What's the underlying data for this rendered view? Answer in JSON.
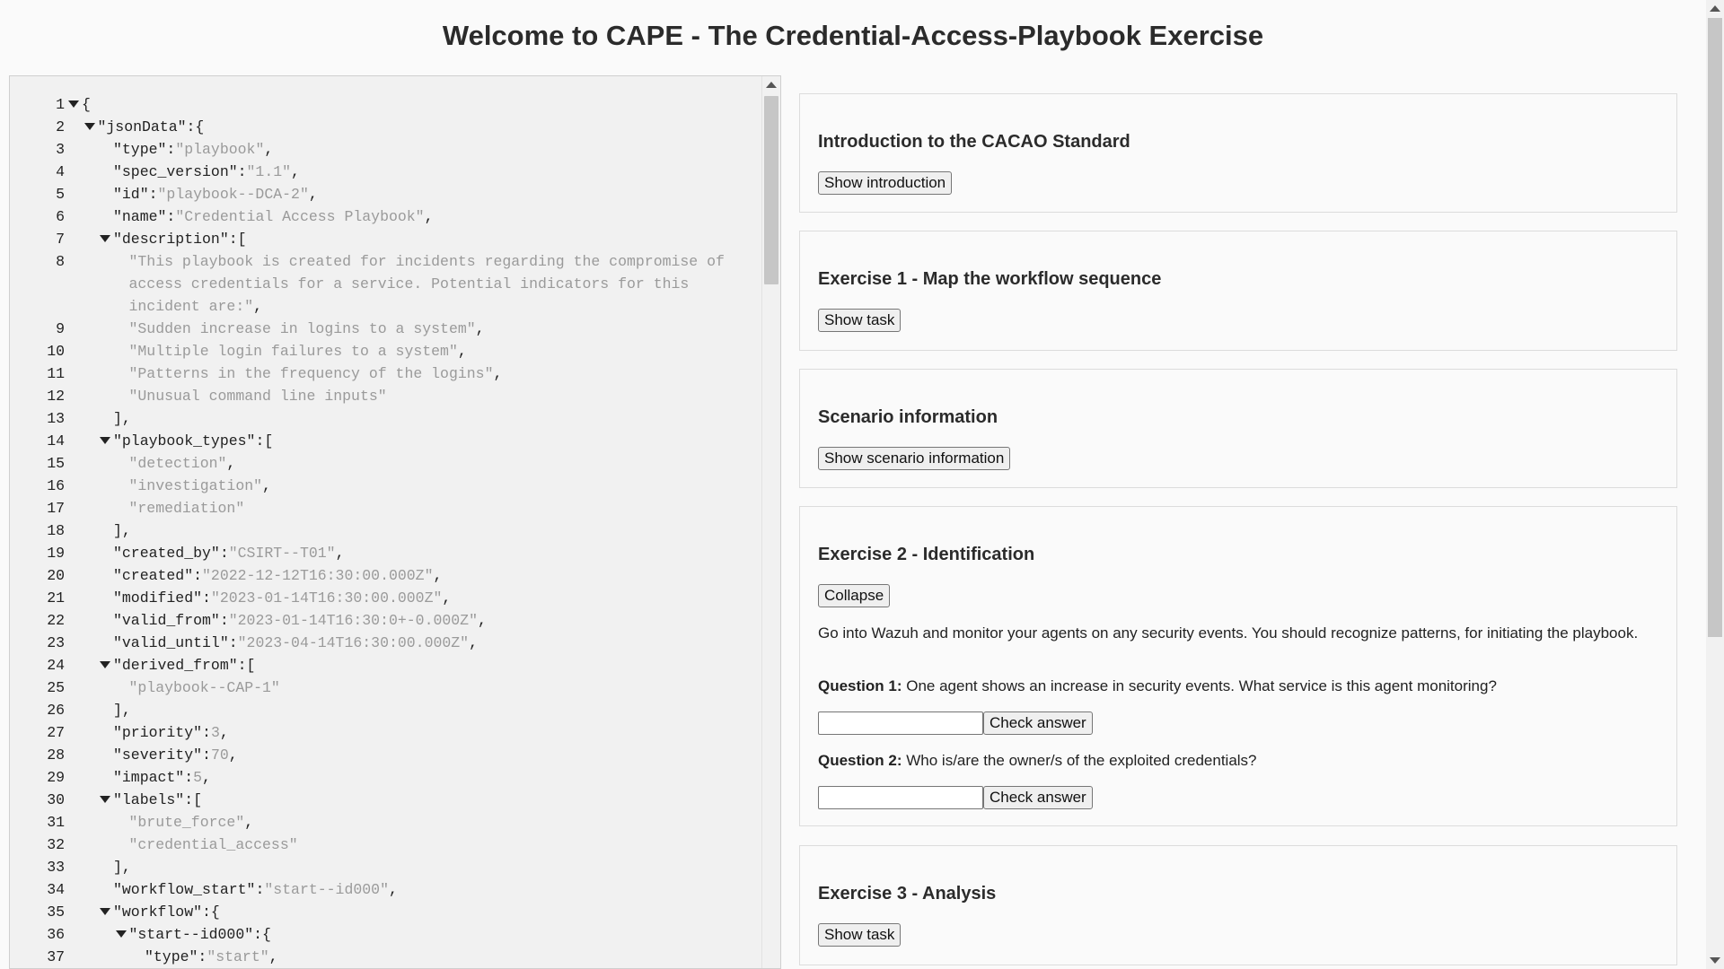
{
  "page": {
    "title": "Welcome to CAPE - The Credential-Access-Playbook Exercise"
  },
  "json_viewer": {
    "lines": [
      {
        "n": "1",
        "indent": 0,
        "toggle": true,
        "parts": [
          [
            "p",
            "{"
          ]
        ]
      },
      {
        "n": "2",
        "indent": 1,
        "toggle": true,
        "parts": [
          [
            "k",
            "\"jsonData\""
          ],
          [
            "p",
            ":{"
          ]
        ]
      },
      {
        "n": "3",
        "indent": 2,
        "parts": [
          [
            "k",
            "\"type\""
          ],
          [
            "p",
            ":"
          ],
          [
            "v",
            "\"playbook\""
          ],
          [
            "p",
            ","
          ]
        ]
      },
      {
        "n": "4",
        "indent": 2,
        "parts": [
          [
            "k",
            "\"spec_version\""
          ],
          [
            "p",
            ":"
          ],
          [
            "v",
            "\"1.1\""
          ],
          [
            "p",
            ","
          ]
        ]
      },
      {
        "n": "5",
        "indent": 2,
        "parts": [
          [
            "k",
            "\"id\""
          ],
          [
            "p",
            ":"
          ],
          [
            "v",
            "\"playbook--DCA-2\""
          ],
          [
            "p",
            ","
          ]
        ]
      },
      {
        "n": "6",
        "indent": 2,
        "parts": [
          [
            "k",
            "\"name\""
          ],
          [
            "p",
            ":"
          ],
          [
            "v",
            "\"Credential Access Playbook\""
          ],
          [
            "p",
            ","
          ]
        ]
      },
      {
        "n": "7",
        "indent": 2,
        "toggle": true,
        "parts": [
          [
            "k",
            "\"description\""
          ],
          [
            "p",
            ":["
          ]
        ]
      },
      {
        "n": "8",
        "indent": 3,
        "parts": [
          [
            "v",
            "\"This playbook is created for incidents regarding the compromise of"
          ]
        ]
      },
      {
        "n": "",
        "indent": 3,
        "parts": [
          [
            "v",
            "access credentials for a service. Potential indicators for this"
          ]
        ]
      },
      {
        "n": "",
        "indent": 3,
        "parts": [
          [
            "v",
            "incident are:\""
          ],
          [
            "p",
            ","
          ]
        ]
      },
      {
        "n": "9",
        "indent": 3,
        "parts": [
          [
            "v",
            "\"Sudden increase in logins to a system\""
          ],
          [
            "p",
            ","
          ]
        ]
      },
      {
        "n": "10",
        "indent": 3,
        "parts": [
          [
            "v",
            "\"Multiple login failures to a system\""
          ],
          [
            "p",
            ","
          ]
        ]
      },
      {
        "n": "11",
        "indent": 3,
        "parts": [
          [
            "v",
            "\"Patterns in the frequency of the logins\""
          ],
          [
            "p",
            ","
          ]
        ]
      },
      {
        "n": "12",
        "indent": 3,
        "parts": [
          [
            "v",
            "\"Unusual command line inputs\""
          ]
        ]
      },
      {
        "n": "13",
        "indent": 2,
        "parts": [
          [
            "p",
            "],"
          ]
        ]
      },
      {
        "n": "14",
        "indent": 2,
        "toggle": true,
        "parts": [
          [
            "k",
            "\"playbook_types\""
          ],
          [
            "p",
            ":["
          ]
        ]
      },
      {
        "n": "15",
        "indent": 3,
        "parts": [
          [
            "v",
            "\"detection\""
          ],
          [
            "p",
            ","
          ]
        ]
      },
      {
        "n": "16",
        "indent": 3,
        "parts": [
          [
            "v",
            "\"investigation\""
          ],
          [
            "p",
            ","
          ]
        ]
      },
      {
        "n": "17",
        "indent": 3,
        "parts": [
          [
            "v",
            "\"remediation\""
          ]
        ]
      },
      {
        "n": "18",
        "indent": 2,
        "parts": [
          [
            "p",
            "],"
          ]
        ]
      },
      {
        "n": "19",
        "indent": 2,
        "parts": [
          [
            "k",
            "\"created_by\""
          ],
          [
            "p",
            ":"
          ],
          [
            "v",
            "\"CSIRT--T01\""
          ],
          [
            "p",
            ","
          ]
        ]
      },
      {
        "n": "20",
        "indent": 2,
        "parts": [
          [
            "k",
            "\"created\""
          ],
          [
            "p",
            ":"
          ],
          [
            "v",
            "\"2022-12-12T16:30:00.000Z\""
          ],
          [
            "p",
            ","
          ]
        ]
      },
      {
        "n": "21",
        "indent": 2,
        "parts": [
          [
            "k",
            "\"modified\""
          ],
          [
            "p",
            ":"
          ],
          [
            "v",
            "\"2023-01-14T16:30:00.000Z\""
          ],
          [
            "p",
            ","
          ]
        ]
      },
      {
        "n": "22",
        "indent": 2,
        "parts": [
          [
            "k",
            "\"valid_from\""
          ],
          [
            "p",
            ":"
          ],
          [
            "v",
            "\"2023-01-14T16:30:0+-0.000Z\""
          ],
          [
            "p",
            ","
          ]
        ]
      },
      {
        "n": "23",
        "indent": 2,
        "parts": [
          [
            "k",
            "\"valid_until\""
          ],
          [
            "p",
            ":"
          ],
          [
            "v",
            "\"2023-04-14T16:30:00.000Z\""
          ],
          [
            "p",
            ","
          ]
        ]
      },
      {
        "n": "24",
        "indent": 2,
        "toggle": true,
        "parts": [
          [
            "k",
            "\"derived_from\""
          ],
          [
            "p",
            ":["
          ]
        ]
      },
      {
        "n": "25",
        "indent": 3,
        "parts": [
          [
            "v",
            "\"playbook--CAP-1\""
          ]
        ]
      },
      {
        "n": "26",
        "indent": 2,
        "parts": [
          [
            "p",
            "],"
          ]
        ]
      },
      {
        "n": "27",
        "indent": 2,
        "parts": [
          [
            "k",
            "\"priority\""
          ],
          [
            "p",
            ":"
          ],
          [
            "n",
            "3"
          ],
          [
            "p",
            ","
          ]
        ]
      },
      {
        "n": "28",
        "indent": 2,
        "parts": [
          [
            "k",
            "\"severity\""
          ],
          [
            "p",
            ":"
          ],
          [
            "n",
            "70"
          ],
          [
            "p",
            ","
          ]
        ]
      },
      {
        "n": "29",
        "indent": 2,
        "parts": [
          [
            "k",
            "\"impact\""
          ],
          [
            "p",
            ":"
          ],
          [
            "n",
            "5"
          ],
          [
            "p",
            ","
          ]
        ]
      },
      {
        "n": "30",
        "indent": 2,
        "toggle": true,
        "parts": [
          [
            "k",
            "\"labels\""
          ],
          [
            "p",
            ":["
          ]
        ]
      },
      {
        "n": "31",
        "indent": 3,
        "parts": [
          [
            "v",
            "\"brute_force\""
          ],
          [
            "p",
            ","
          ]
        ]
      },
      {
        "n": "32",
        "indent": 3,
        "parts": [
          [
            "v",
            "\"credential_access\""
          ]
        ]
      },
      {
        "n": "33",
        "indent": 2,
        "parts": [
          [
            "p",
            "],"
          ]
        ]
      },
      {
        "n": "34",
        "indent": 2,
        "parts": [
          [
            "k",
            "\"workflow_start\""
          ],
          [
            "p",
            ":"
          ],
          [
            "v",
            "\"start--id000\""
          ],
          [
            "p",
            ","
          ]
        ]
      },
      {
        "n": "35",
        "indent": 2,
        "toggle": true,
        "parts": [
          [
            "k",
            "\"workflow\""
          ],
          [
            "p",
            ":{"
          ]
        ]
      },
      {
        "n": "36",
        "indent": 3,
        "toggle": true,
        "parts": [
          [
            "k",
            "\"start--id000\""
          ],
          [
            "p",
            ":{"
          ]
        ]
      },
      {
        "n": "37",
        "indent": 4,
        "parts": [
          [
            "k",
            "\"type\""
          ],
          [
            "p",
            ":"
          ],
          [
            "v",
            "\"start\""
          ],
          [
            "p",
            ","
          ]
        ]
      }
    ]
  },
  "cards": {
    "intro": {
      "title": "Introduction to the CACAO Standard",
      "button": "Show introduction"
    },
    "exercise1": {
      "title": "Exercise 1 - Map the workflow sequence",
      "button": "Show task"
    },
    "scenario": {
      "title": "Scenario information",
      "button": "Show scenario information"
    },
    "exercise2": {
      "title": "Exercise 2 - Identification",
      "button": "Collapse",
      "text": "Go into Wazuh and monitor your agents on any security events. You should recognize patterns, for initiating the playbook.",
      "q1_label": "Question 1:",
      "q1_text": " One agent shows an increase in security events. What service is this agent monitoring?",
      "q1_value": "",
      "q2_label": "Question 2:",
      "q2_text": " Who is/are the owner/s of the exploited credentials?",
      "q2_value": "",
      "check_label": "Check answer"
    },
    "exercise3": {
      "title": "Exercise 3 - Analysis",
      "button": "Show task"
    }
  }
}
